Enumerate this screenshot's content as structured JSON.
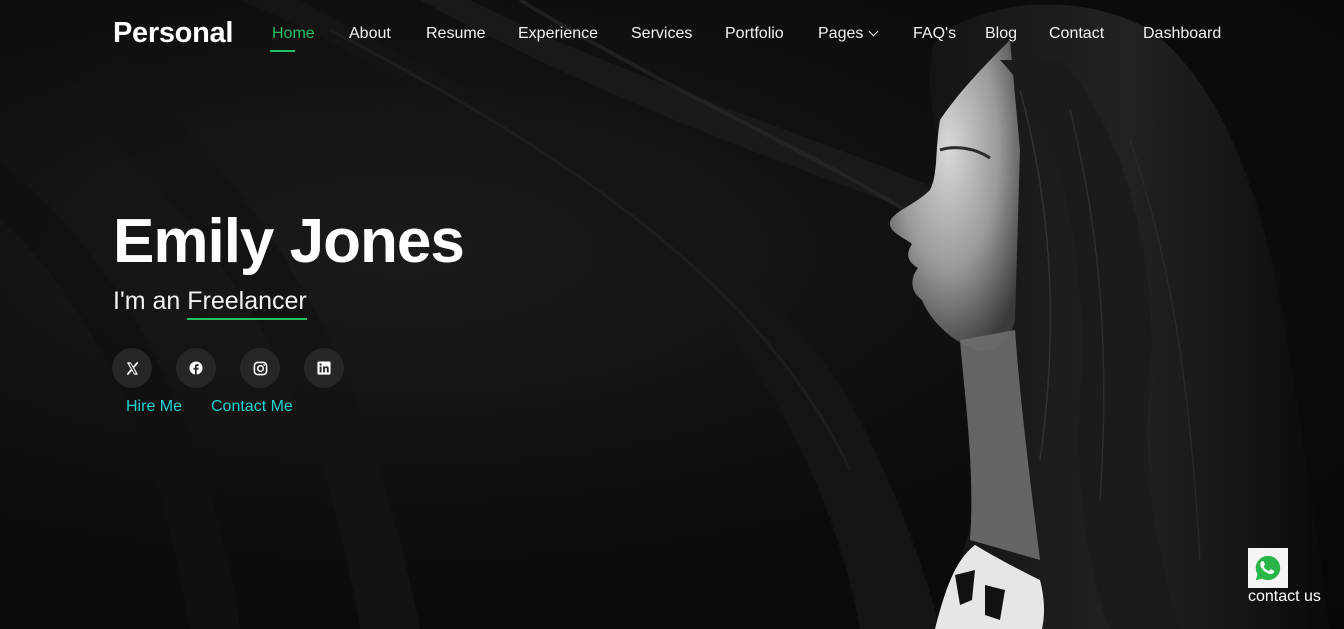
{
  "brand": {
    "name": "Personal"
  },
  "nav": {
    "items": [
      {
        "label": "Home",
        "active": true
      },
      {
        "label": "About"
      },
      {
        "label": "Resume"
      },
      {
        "label": "Experience"
      },
      {
        "label": "Services"
      },
      {
        "label": "Portfolio"
      },
      {
        "label": "Pages",
        "has_dropdown": true
      },
      {
        "label": "FAQ's"
      },
      {
        "label": "Blog"
      },
      {
        "label": "Contact"
      },
      {
        "label": "Dashboard"
      }
    ]
  },
  "hero": {
    "name": "Emily Jones",
    "subtitle_prefix": "I'm an",
    "typed_word": "Freelancer",
    "socials": [
      {
        "icon": "x-twitter-icon"
      },
      {
        "icon": "facebook-icon"
      },
      {
        "icon": "instagram-icon"
      },
      {
        "icon": "linkedin-icon"
      }
    ],
    "cta": {
      "hire": "Hire Me",
      "contact": "Contact Me"
    }
  },
  "whatsapp": {
    "icon": "whatsapp-icon",
    "label": "contact us"
  },
  "colors": {
    "accent": "#20c063",
    "cta_text": "#1bd3d3",
    "background": "#0b0b0b",
    "social_bg": "#262626"
  }
}
